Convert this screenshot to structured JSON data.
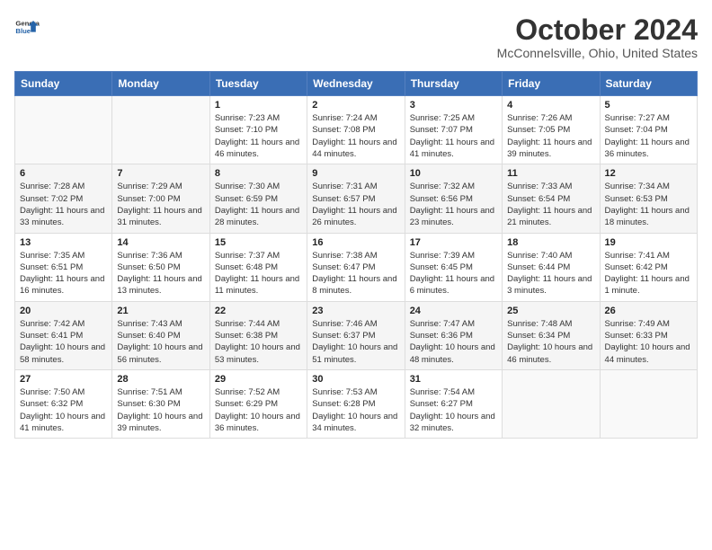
{
  "logo": {
    "general": "General",
    "blue": "Blue"
  },
  "title": "October 2024",
  "location": "McConnelsville, Ohio, United States",
  "weekdays": [
    "Sunday",
    "Monday",
    "Tuesday",
    "Wednesday",
    "Thursday",
    "Friday",
    "Saturday"
  ],
  "weeks": [
    [
      {
        "day": "",
        "info": ""
      },
      {
        "day": "",
        "info": ""
      },
      {
        "day": "1",
        "info": "Sunrise: 7:23 AM\nSunset: 7:10 PM\nDaylight: 11 hours and 46 minutes."
      },
      {
        "day": "2",
        "info": "Sunrise: 7:24 AM\nSunset: 7:08 PM\nDaylight: 11 hours and 44 minutes."
      },
      {
        "day": "3",
        "info": "Sunrise: 7:25 AM\nSunset: 7:07 PM\nDaylight: 11 hours and 41 minutes."
      },
      {
        "day": "4",
        "info": "Sunrise: 7:26 AM\nSunset: 7:05 PM\nDaylight: 11 hours and 39 minutes."
      },
      {
        "day": "5",
        "info": "Sunrise: 7:27 AM\nSunset: 7:04 PM\nDaylight: 11 hours and 36 minutes."
      }
    ],
    [
      {
        "day": "6",
        "info": "Sunrise: 7:28 AM\nSunset: 7:02 PM\nDaylight: 11 hours and 33 minutes."
      },
      {
        "day": "7",
        "info": "Sunrise: 7:29 AM\nSunset: 7:00 PM\nDaylight: 11 hours and 31 minutes."
      },
      {
        "day": "8",
        "info": "Sunrise: 7:30 AM\nSunset: 6:59 PM\nDaylight: 11 hours and 28 minutes."
      },
      {
        "day": "9",
        "info": "Sunrise: 7:31 AM\nSunset: 6:57 PM\nDaylight: 11 hours and 26 minutes."
      },
      {
        "day": "10",
        "info": "Sunrise: 7:32 AM\nSunset: 6:56 PM\nDaylight: 11 hours and 23 minutes."
      },
      {
        "day": "11",
        "info": "Sunrise: 7:33 AM\nSunset: 6:54 PM\nDaylight: 11 hours and 21 minutes."
      },
      {
        "day": "12",
        "info": "Sunrise: 7:34 AM\nSunset: 6:53 PM\nDaylight: 11 hours and 18 minutes."
      }
    ],
    [
      {
        "day": "13",
        "info": "Sunrise: 7:35 AM\nSunset: 6:51 PM\nDaylight: 11 hours and 16 minutes."
      },
      {
        "day": "14",
        "info": "Sunrise: 7:36 AM\nSunset: 6:50 PM\nDaylight: 11 hours and 13 minutes."
      },
      {
        "day": "15",
        "info": "Sunrise: 7:37 AM\nSunset: 6:48 PM\nDaylight: 11 hours and 11 minutes."
      },
      {
        "day": "16",
        "info": "Sunrise: 7:38 AM\nSunset: 6:47 PM\nDaylight: 11 hours and 8 minutes."
      },
      {
        "day": "17",
        "info": "Sunrise: 7:39 AM\nSunset: 6:45 PM\nDaylight: 11 hours and 6 minutes."
      },
      {
        "day": "18",
        "info": "Sunrise: 7:40 AM\nSunset: 6:44 PM\nDaylight: 11 hours and 3 minutes."
      },
      {
        "day": "19",
        "info": "Sunrise: 7:41 AM\nSunset: 6:42 PM\nDaylight: 11 hours and 1 minute."
      }
    ],
    [
      {
        "day": "20",
        "info": "Sunrise: 7:42 AM\nSunset: 6:41 PM\nDaylight: 10 hours and 58 minutes."
      },
      {
        "day": "21",
        "info": "Sunrise: 7:43 AM\nSunset: 6:40 PM\nDaylight: 10 hours and 56 minutes."
      },
      {
        "day": "22",
        "info": "Sunrise: 7:44 AM\nSunset: 6:38 PM\nDaylight: 10 hours and 53 minutes."
      },
      {
        "day": "23",
        "info": "Sunrise: 7:46 AM\nSunset: 6:37 PM\nDaylight: 10 hours and 51 minutes."
      },
      {
        "day": "24",
        "info": "Sunrise: 7:47 AM\nSunset: 6:36 PM\nDaylight: 10 hours and 48 minutes."
      },
      {
        "day": "25",
        "info": "Sunrise: 7:48 AM\nSunset: 6:34 PM\nDaylight: 10 hours and 46 minutes."
      },
      {
        "day": "26",
        "info": "Sunrise: 7:49 AM\nSunset: 6:33 PM\nDaylight: 10 hours and 44 minutes."
      }
    ],
    [
      {
        "day": "27",
        "info": "Sunrise: 7:50 AM\nSunset: 6:32 PM\nDaylight: 10 hours and 41 minutes."
      },
      {
        "day": "28",
        "info": "Sunrise: 7:51 AM\nSunset: 6:30 PM\nDaylight: 10 hours and 39 minutes."
      },
      {
        "day": "29",
        "info": "Sunrise: 7:52 AM\nSunset: 6:29 PM\nDaylight: 10 hours and 36 minutes."
      },
      {
        "day": "30",
        "info": "Sunrise: 7:53 AM\nSunset: 6:28 PM\nDaylight: 10 hours and 34 minutes."
      },
      {
        "day": "31",
        "info": "Sunrise: 7:54 AM\nSunset: 6:27 PM\nDaylight: 10 hours and 32 minutes."
      },
      {
        "day": "",
        "info": ""
      },
      {
        "day": "",
        "info": ""
      }
    ]
  ]
}
